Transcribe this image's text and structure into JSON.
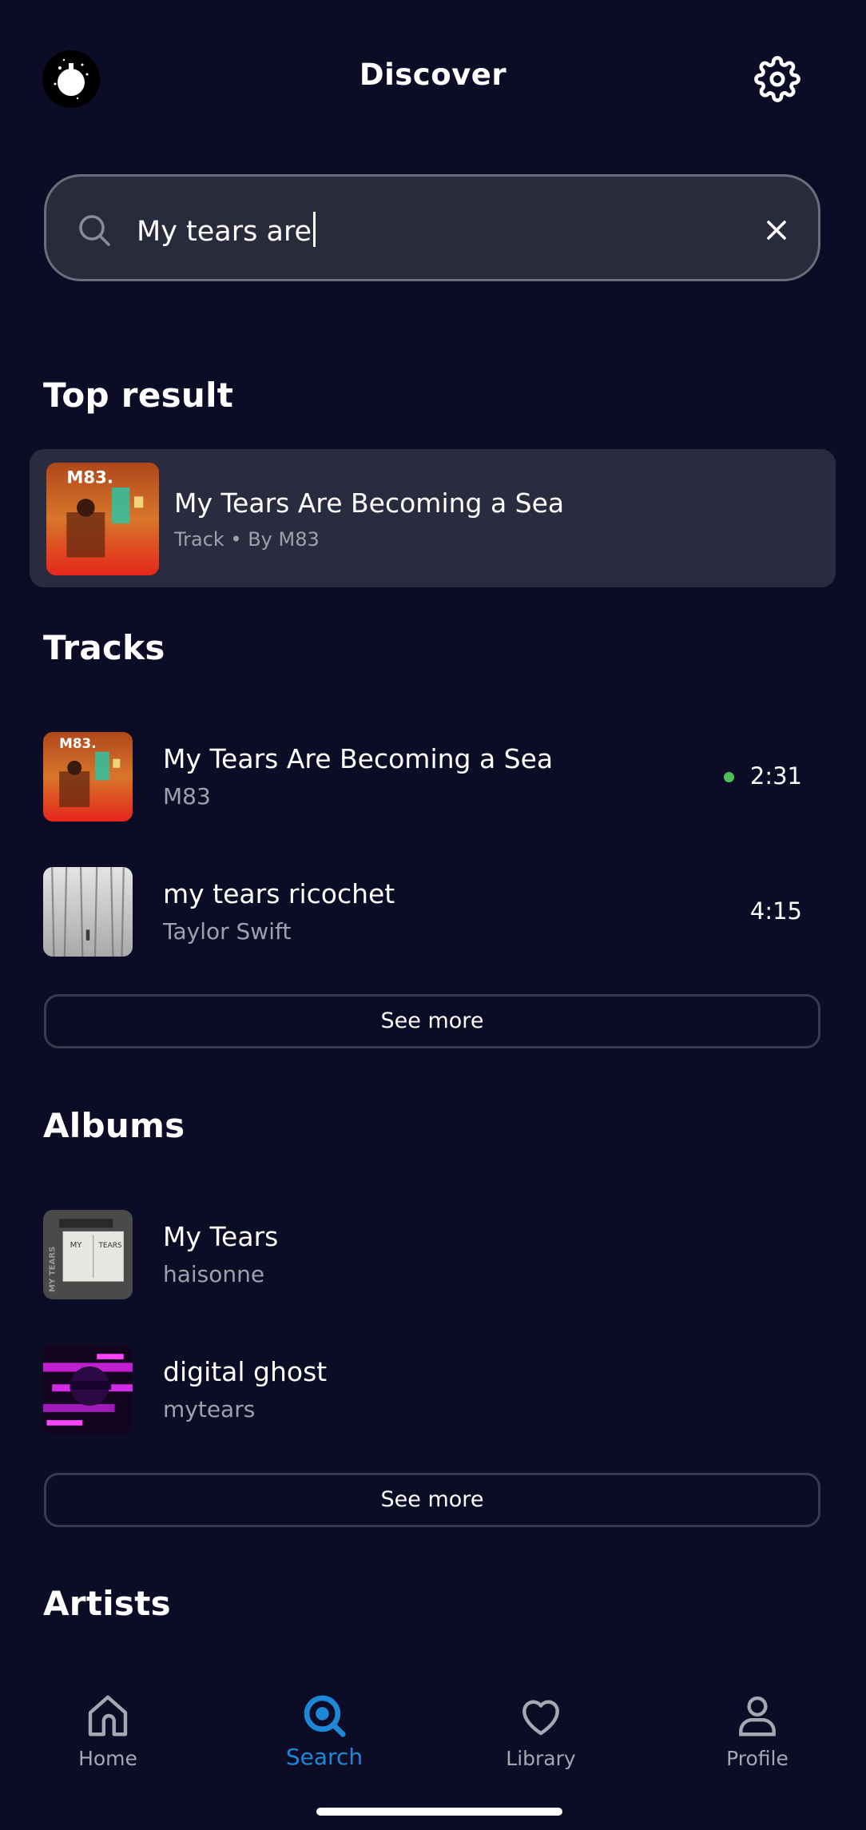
{
  "header": {
    "title": "Discover",
    "avatar_icon": "avatar-icon",
    "settings_icon": "gear-icon"
  },
  "search": {
    "value": "My tears are",
    "icon": "search-icon",
    "clear_icon": "close-icon"
  },
  "top_result": {
    "heading": "Top result",
    "title": "My Tears Are Becoming a Sea",
    "subtitle": "Track • By M83",
    "cover_label": "M83."
  },
  "tracks": {
    "heading": "Tracks",
    "items": [
      {
        "title": "My Tears Are Becoming a Sea",
        "artist": "M83",
        "duration": "2:31",
        "playing": true,
        "cover_label": "M83."
      },
      {
        "title": "my tears ricochet",
        "artist": "Taylor Swift",
        "duration": "4:15",
        "playing": false
      }
    ],
    "see_more": "See more"
  },
  "albums": {
    "heading": "Albums",
    "items": [
      {
        "title": "My Tears",
        "artist": "haisonne",
        "cover_label": "MY TEARS"
      },
      {
        "title": "digital ghost",
        "artist": "mytears"
      }
    ],
    "see_more": "See more"
  },
  "artists": {
    "heading": "Artists"
  },
  "nav": {
    "items": [
      {
        "label": "Home",
        "icon": "home-icon",
        "active": false
      },
      {
        "label": "Search",
        "icon": "search-icon",
        "active": true
      },
      {
        "label": "Library",
        "icon": "heart-icon",
        "active": false
      },
      {
        "label": "Profile",
        "icon": "profile-icon",
        "active": false
      }
    ]
  },
  "colors": {
    "background": "#0c0c26",
    "card": "#2b2b3f",
    "accent": "#1e88d8",
    "playing_dot": "#4fbe5a",
    "secondary_text": "#a0a0ad"
  }
}
